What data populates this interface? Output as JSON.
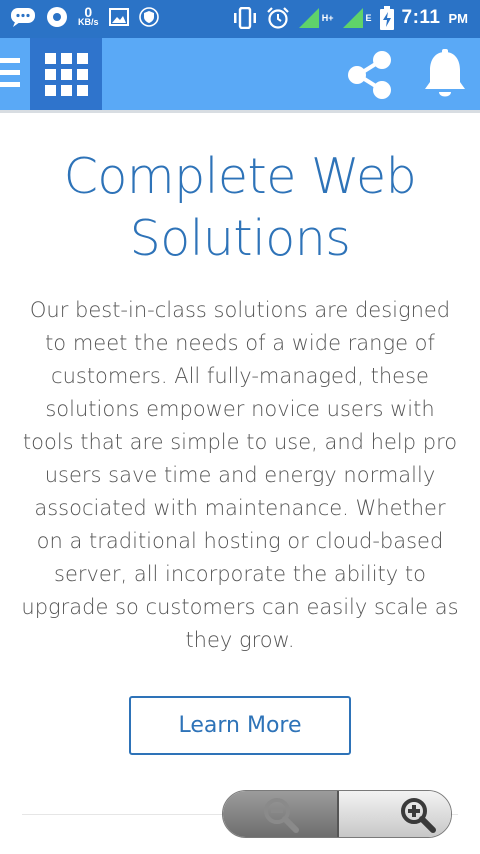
{
  "status_bar": {
    "speed_value": "0",
    "speed_unit": "KB/s",
    "net_h_label": "H+",
    "net_e_label": "E",
    "time": "7:11",
    "ampm": "PM",
    "icons": [
      "chat-icon",
      "record-icon",
      "image-icon",
      "shield-icon",
      "vibrate-icon",
      "alarm-icon",
      "signal-icon",
      "signal-icon",
      "battery-charging-icon"
    ]
  },
  "header": {
    "icons": [
      "menu-icon",
      "grid-icon",
      "share-icon",
      "bell-icon"
    ],
    "colors": {
      "bar": "#5aa9f6",
      "active": "#2f74cc",
      "status": "#2b73c6"
    }
  },
  "main": {
    "title_line1": "Complete Web",
    "title_line2": "Solutions",
    "description": "Our best-in-class solutions are designed to meet the needs of a wide range of customers. All fully-managed, these solutions empower novice users with tools that are simple to use, and help pro users save time and energy normally associated with maintenance. Whether on a traditional hosting or cloud-based server, all incorporate the ability to upgrade so customers can easily scale as they grow.",
    "cta_label": "Learn More",
    "accent_color": "#2e73b8"
  },
  "zoom_control": {
    "icons": [
      "zoom-out-icon",
      "zoom-in-icon"
    ]
  }
}
